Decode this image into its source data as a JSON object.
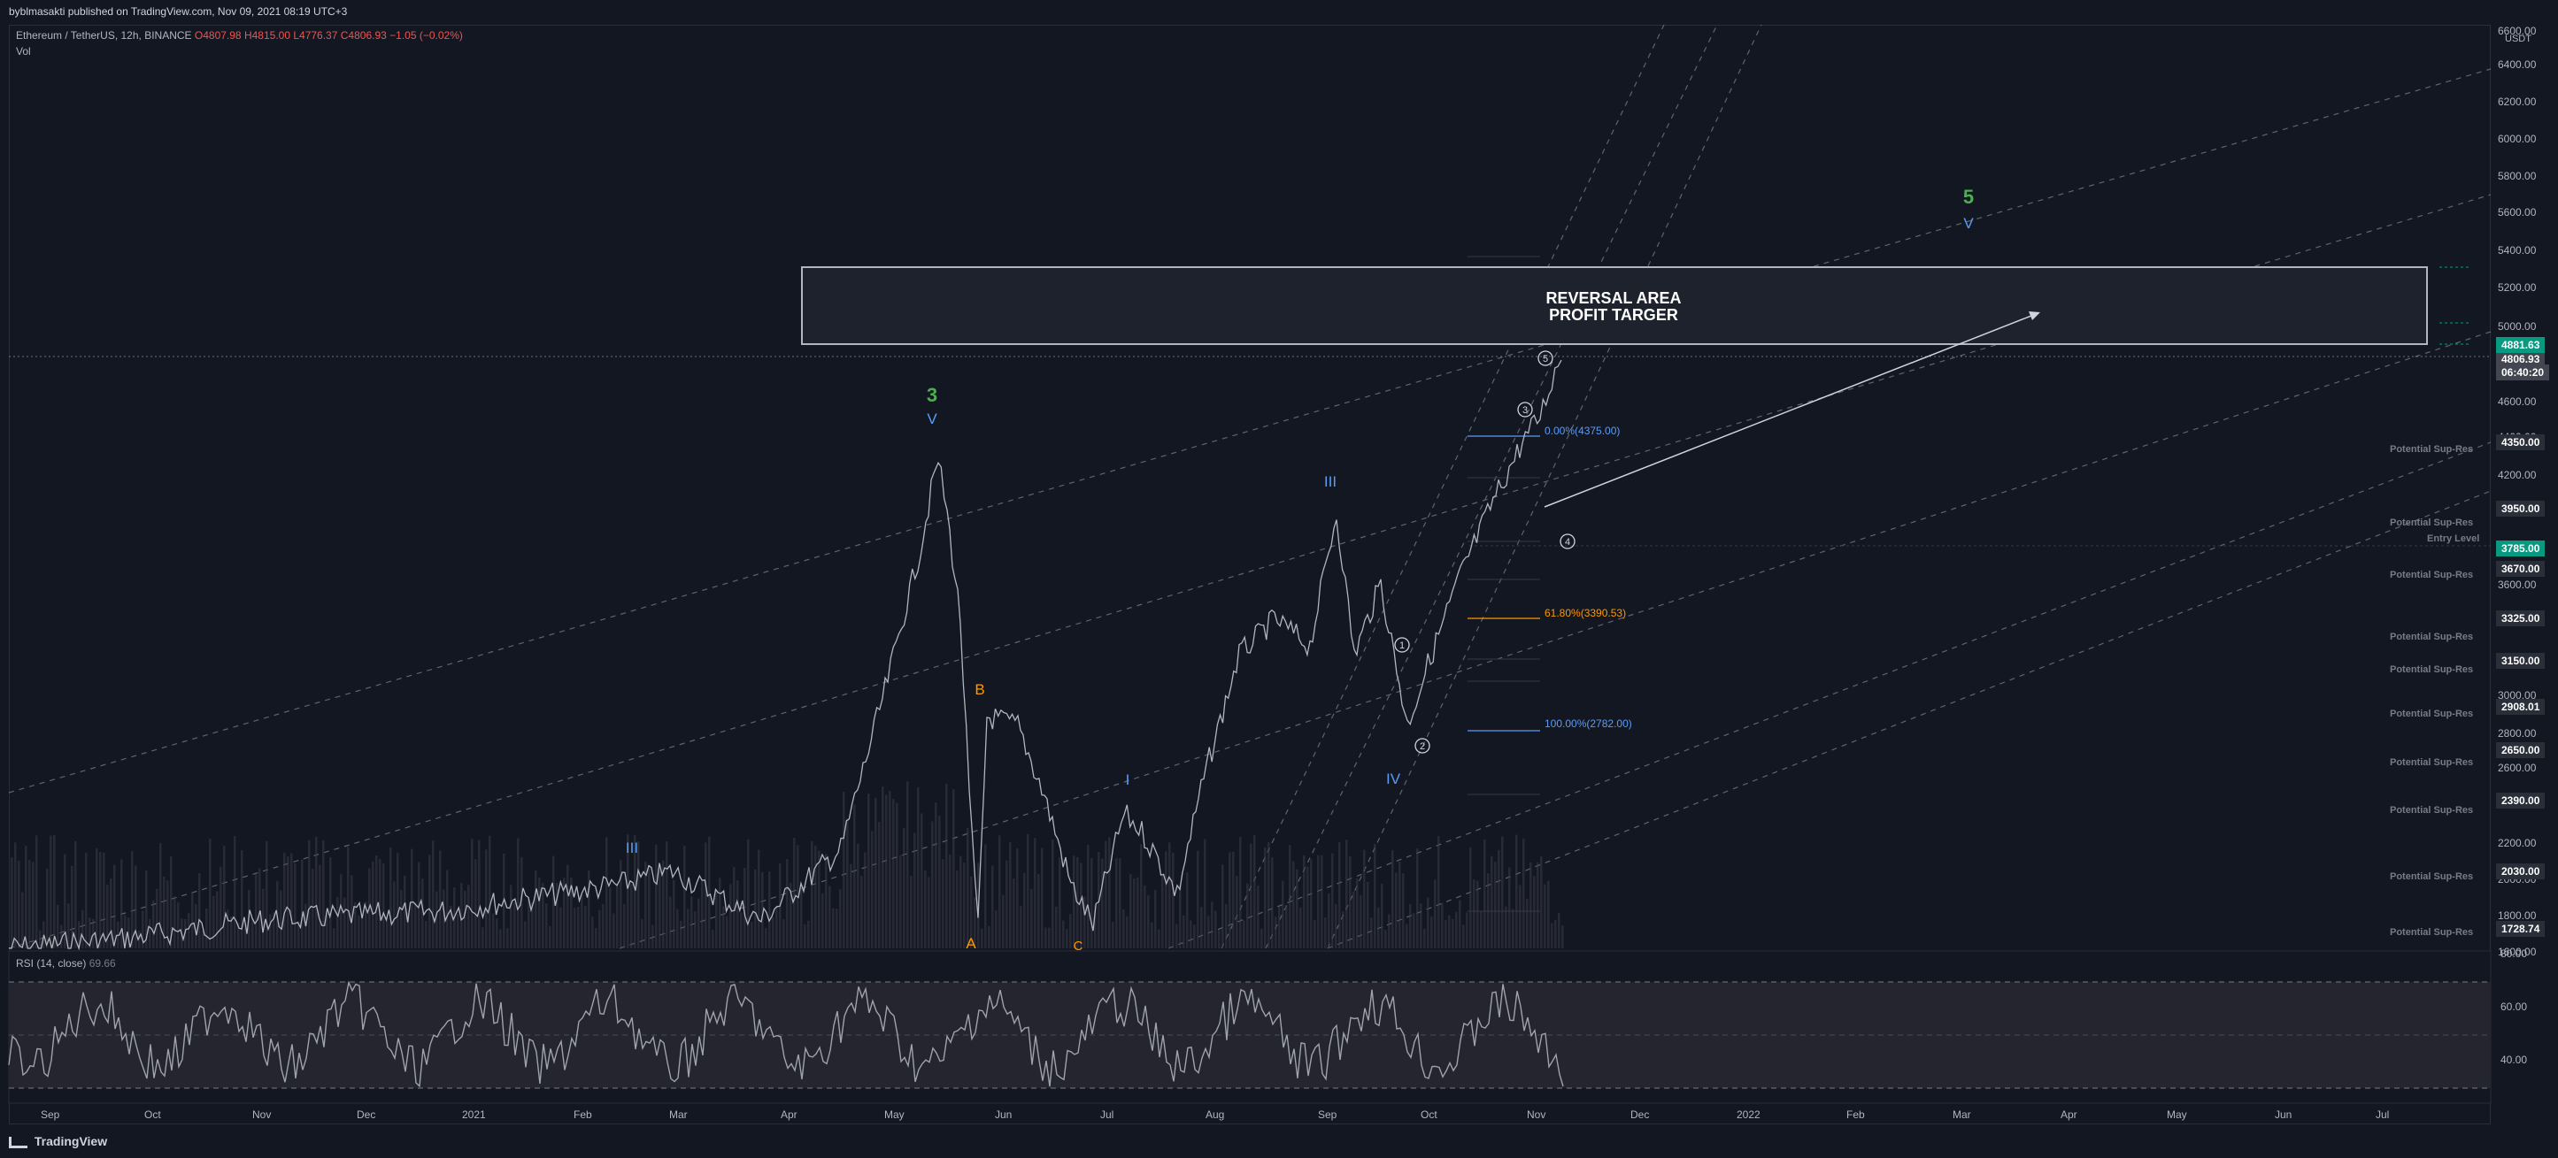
{
  "header": {
    "publisher": "byblmasakti published on TradingView.com, Nov 09, 2021 08:19 UTC+3",
    "symbol": "Ethereum / TetherUS, 12h, BINANCE",
    "open": "O4807.98",
    "high": "H4815.00",
    "low": "L4776.37",
    "close": "C4806.93",
    "change": "−1.05 (−0.02%)",
    "vol_label": "Vol"
  },
  "rsi": {
    "label": "RSI (14, close)",
    "value": "69.66",
    "levels": [
      "80.00",
      "60.00",
      "40.00"
    ]
  },
  "price_axis": {
    "unit": "USDT",
    "levels": [
      "6600.00",
      "6400.00",
      "6200.00",
      "6000.00",
      "5800.00",
      "5600.00",
      "5400.00",
      "5200.00",
      "5000.00",
      "4600.00",
      "4400.00",
      "4200.00",
      "4000.00",
      "3600.00",
      "3400.00",
      "3200.00",
      "3000.00",
      "2800.00",
      "2600.00",
      "2200.00",
      "2000.00",
      "1800.00",
      "1600.00"
    ]
  },
  "price_badges": {
    "current_price": "4806.93",
    "countdown": "06:40:20",
    "top_level": "4881.63",
    "entry_level": "3785.00",
    "sr_values": [
      "4350.00",
      "3950.00",
      "3670.00",
      "3325.00",
      "3150.00",
      "2908.01",
      "2650.00",
      "2390.00",
      "2030.00",
      "1728.74"
    ]
  },
  "sr_labels": [
    "Potential Sup-Res",
    "Potential Sup-Res",
    "Entry Level",
    "Potential Sup-Res",
    "Potential Sup-Res",
    "Potential Sup-Res",
    "Potential Sup-Res",
    "Potential Sup-Res",
    "Potential Sup-Res",
    "Potential Sup-Res",
    "Potential Sup-Res"
  ],
  "time_axis": [
    "Sep",
    "Oct",
    "Nov",
    "Dec",
    "2021",
    "Feb",
    "Mar",
    "Apr",
    "May",
    "Jun",
    "Jul",
    "Aug",
    "Sep",
    "Oct",
    "Nov",
    "Dec",
    "2022",
    "Feb",
    "Mar",
    "Apr",
    "May",
    "Jun",
    "Jul"
  ],
  "annotations": {
    "box_line1": "REVERSAL AREA",
    "box_line2": "PROFIT TARGER",
    "wave3_number": "3",
    "wave3_roman": "V",
    "wave5_number": "5",
    "wave5_roman": "V",
    "wave_a": "A",
    "wave_b": "B",
    "wave_c": "C",
    "wave_i": "I",
    "wave_iii_left": "III",
    "wave_iii_right": "III",
    "wave_iv": "IV",
    "circle1": "1",
    "circle2": "2",
    "circle3": "3",
    "circle4": "4",
    "circle5": "5"
  },
  "fibs": {
    "fib_0": "0.00%(4375.00)",
    "fib_618": "61.80%(3390.53)",
    "fib_100": "100.00%(2782.00)"
  },
  "colors": {
    "background": "#131722",
    "green": "#4caf50",
    "blue": "#5b9cf6",
    "orange": "#ff9800",
    "badge_green": "#089981",
    "red": "#ef5350"
  },
  "branding": "TradingView"
}
